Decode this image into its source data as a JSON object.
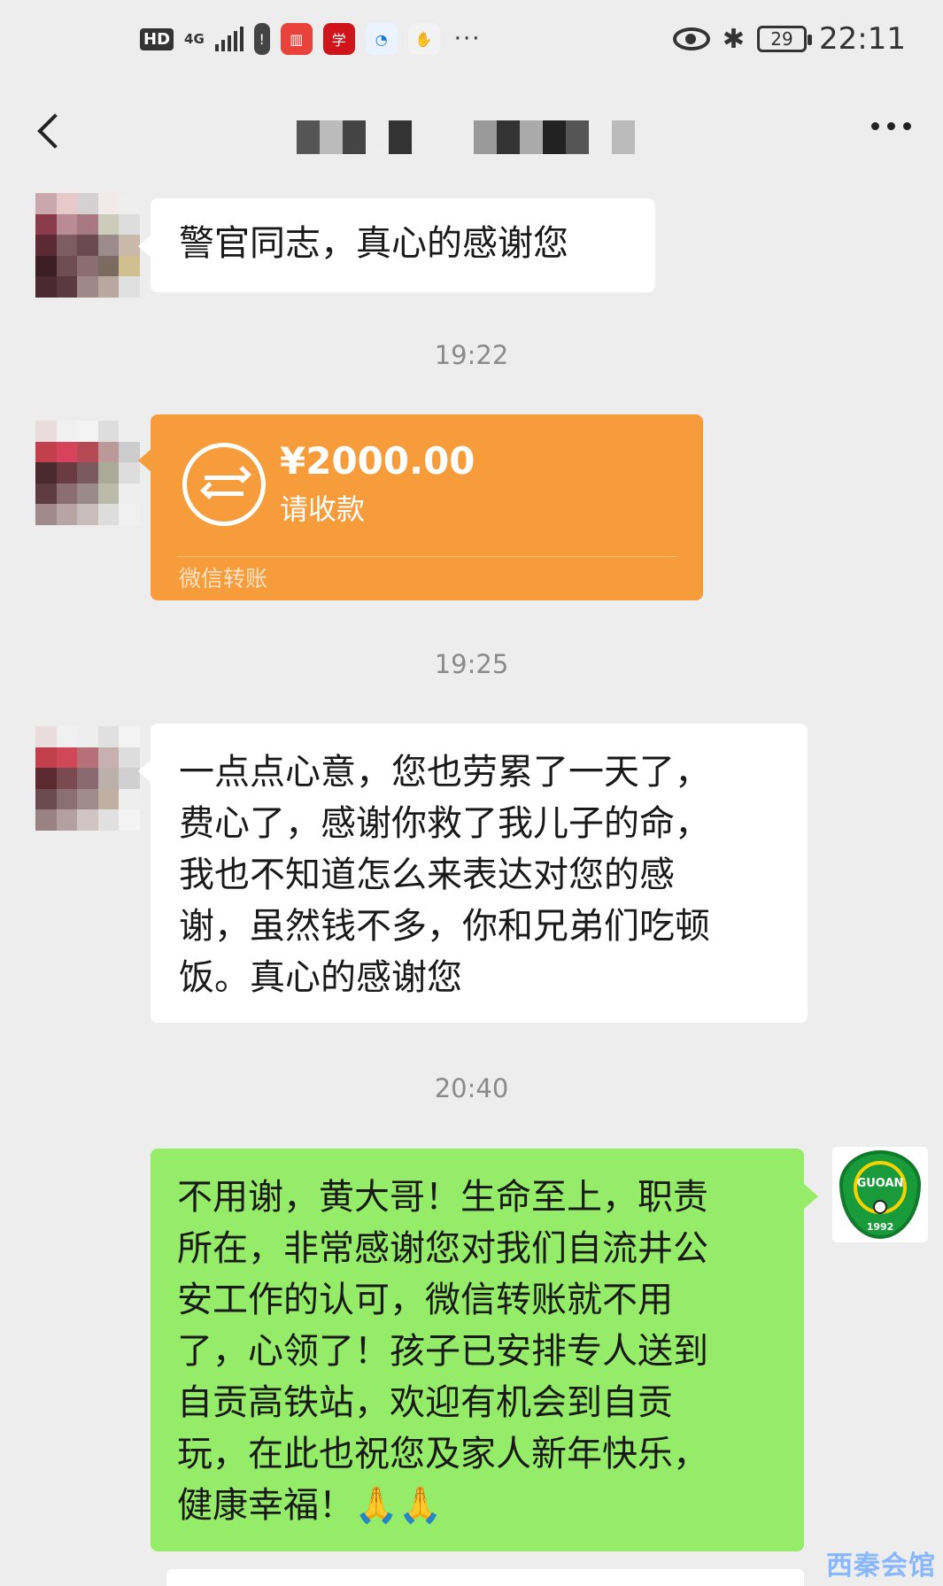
{
  "status_bar": {
    "hd": "HD",
    "network": "4G",
    "battery": "29",
    "time": "22:11",
    "more": "···"
  },
  "nav": {
    "back_icon": "chevron-left-icon",
    "more_icon": "more-dots-icon"
  },
  "messages": [
    {
      "type": "text",
      "side": "left",
      "text": "警官同志，真心的感谢您"
    },
    {
      "type": "timestamp",
      "text": "19:22"
    },
    {
      "type": "transfer",
      "side": "left",
      "amount": "¥2000.00",
      "status": "请收款",
      "footer": "微信转账"
    },
    {
      "type": "timestamp",
      "text": "19:25"
    },
    {
      "type": "text",
      "side": "left",
      "text": "一点点心意，您也劳累了一天了，\n费心了，感谢你救了我儿子的命，\n我也不知道怎么来表达对您的感\n谢，虽然钱不多，你和兄弟们吃顿\n饭。真心的感谢您"
    },
    {
      "type": "timestamp",
      "text": "20:40"
    },
    {
      "type": "text",
      "side": "right",
      "text": "不用谢，黄大哥！生命至上，职责\n所在，非常感谢您对我们自流井公\n安工作的认可，微信转账就不用\n了，心领了！孩子已安排专人送到\n自贡高铁站，欢迎有机会到自贡\n玩，在此也祝您及家人新年快乐，\n健康幸福！🙏🙏"
    }
  ],
  "my_avatar_badge": {
    "text_top": "GUOAN",
    "text_mid": "GUOAN",
    "year": "1992"
  },
  "watermark": "西秦会馆",
  "colors": {
    "green_bubble": "#95ec69",
    "transfer": "#f79c3a",
    "background": "#ededed"
  }
}
